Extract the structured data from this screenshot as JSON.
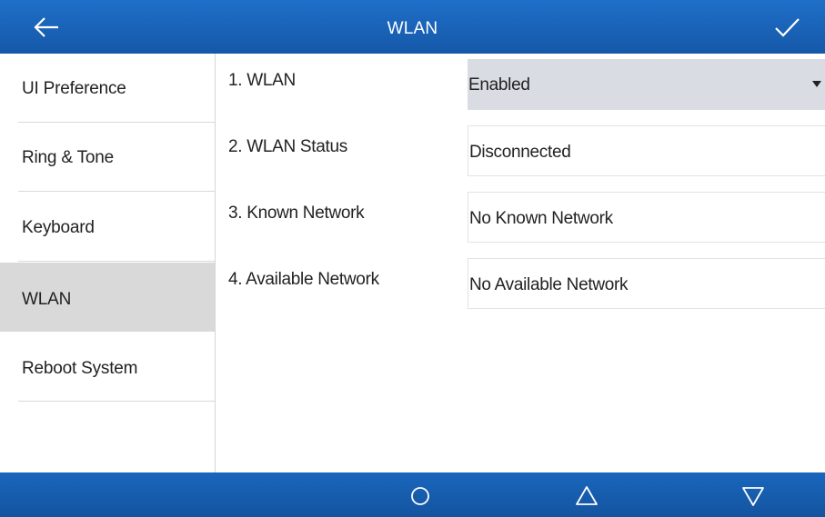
{
  "header": {
    "title": "WLAN",
    "back_icon": "arrow-left-icon",
    "confirm_icon": "checkmark-icon"
  },
  "sidebar": {
    "items": [
      {
        "label": "UI Preference",
        "active": false
      },
      {
        "label": "Ring & Tone",
        "active": false
      },
      {
        "label": "Keyboard",
        "active": false
      },
      {
        "label": "WLAN",
        "active": true
      },
      {
        "label": "Reboot System",
        "active": false
      }
    ]
  },
  "settings": {
    "rows": [
      {
        "label": "1. WLAN",
        "value": "Enabled",
        "type": "select"
      },
      {
        "label": "2. WLAN Status",
        "value": "Disconnected",
        "type": "readonly"
      },
      {
        "label": "3. Known Network",
        "value": "No Known Network",
        "type": "link"
      },
      {
        "label": "4. Available Network",
        "value": "No Available Network",
        "type": "link"
      }
    ]
  },
  "navbar": {
    "buttons": [
      "home-circle-icon",
      "triangle-up-icon",
      "triangle-down-icon"
    ]
  },
  "colors": {
    "header_bg": "#1a62b8",
    "navbar_bg": "#1a66bd",
    "active_item_bg": "#d9d9d9",
    "select_bg": "#d9dde3"
  }
}
